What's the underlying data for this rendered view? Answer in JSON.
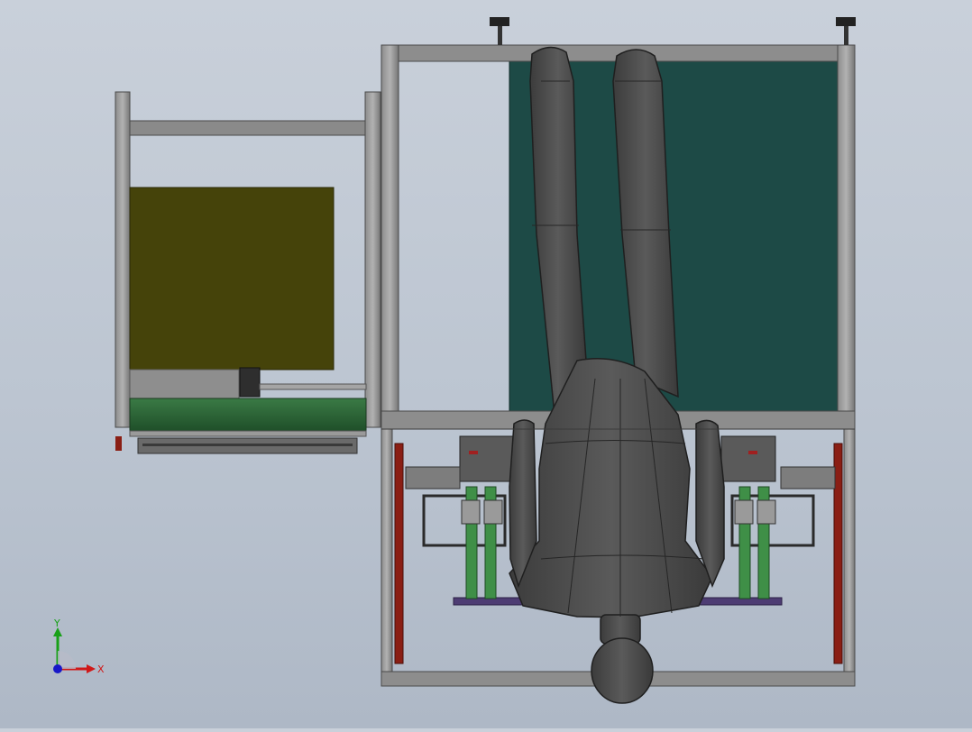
{
  "viewport": {
    "colors": {
      "background_top": "#c9d0da",
      "background_bottom": "#aeb8c6",
      "frame": "#7f7f7f",
      "frame_dark": "#4a4a4a",
      "teal_panel": "#1d4a46",
      "olive_panel": "#45430a",
      "green_conveyor": "#2f6a3a",
      "mannequin": "#4b4b4b",
      "mannequin_outline": "#1f1f1f",
      "red_rail": "#8a1e14",
      "green_column": "#3f8f47",
      "purple_plate": "#4d3c73"
    },
    "icons": {
      "mannequin": "mannequin-icon",
      "machine": "machine-frame-icon"
    }
  },
  "triad": {
    "x_label": "X",
    "y_label": "Y",
    "x_color": "#d01818",
    "y_color": "#18a018",
    "z_color": "#1818c8"
  }
}
